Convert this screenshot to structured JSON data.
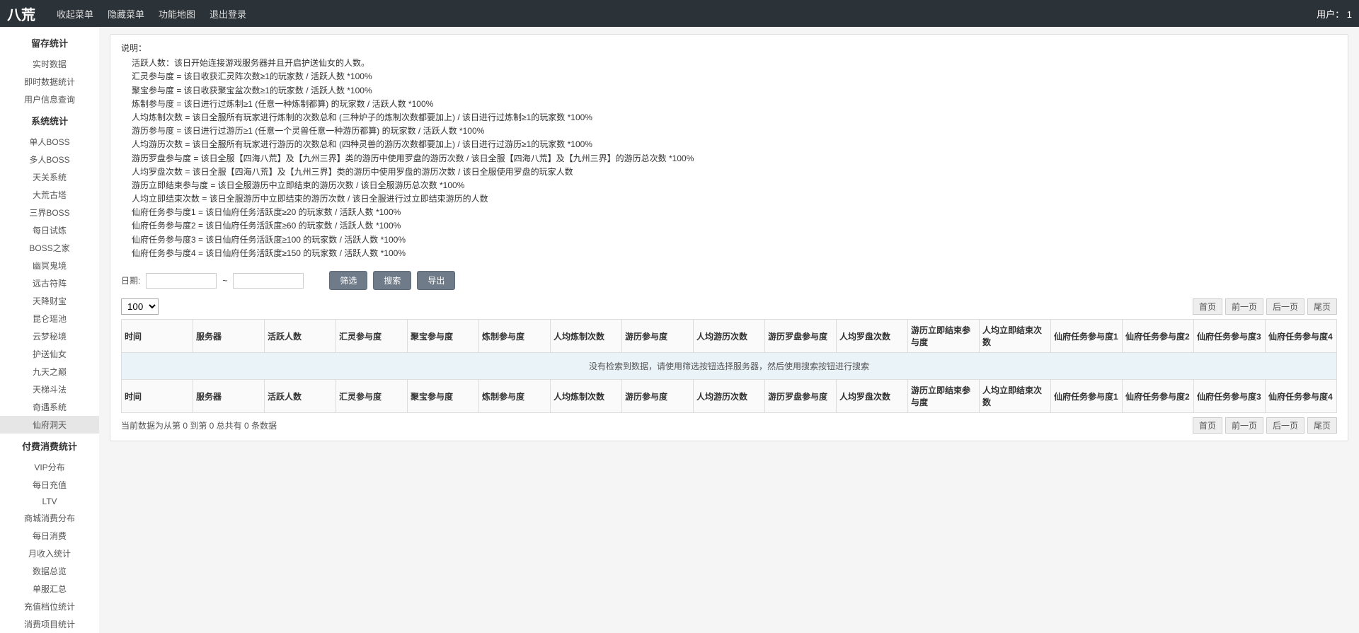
{
  "topbar": {
    "brand": "八荒",
    "links": {
      "collapse": "收起菜单",
      "hide": "隐藏菜单",
      "map": "功能地图",
      "logout": "退出登录"
    },
    "user_label": "用户：",
    "user_value": "1"
  },
  "sidebar": {
    "groups": [
      {
        "title": "留存统计",
        "items": [
          {
            "label": "实时数据"
          },
          {
            "label": "即时数据统计"
          },
          {
            "label": "用户信息查询"
          }
        ]
      },
      {
        "title": "系统统计",
        "items": [
          {
            "label": "单人BOSS"
          },
          {
            "label": "多人BOSS"
          },
          {
            "label": "天关系统"
          },
          {
            "label": "大荒古塔"
          },
          {
            "label": "三界BOSS"
          },
          {
            "label": "每日试炼"
          },
          {
            "label": "BOSS之家"
          },
          {
            "label": "幽冥鬼境"
          },
          {
            "label": "远古符阵"
          },
          {
            "label": "天降财宝"
          },
          {
            "label": "昆仑瑶池"
          },
          {
            "label": "云梦秘境"
          },
          {
            "label": "护送仙女"
          },
          {
            "label": "九天之巅"
          },
          {
            "label": "天梯斗法"
          },
          {
            "label": "奇遇系统"
          },
          {
            "label": "仙府洞天",
            "active": true
          }
        ]
      },
      {
        "title": "付费消费统计",
        "items": [
          {
            "label": "VIP分布"
          },
          {
            "label": "每日充值"
          },
          {
            "label": "LTV"
          },
          {
            "label": "商城消费分布"
          },
          {
            "label": "每日消费"
          },
          {
            "label": "月收入统计"
          },
          {
            "label": "数据总览"
          },
          {
            "label": "单服汇总"
          },
          {
            "label": "充值档位统计"
          },
          {
            "label": "消费项目统计"
          }
        ]
      }
    ]
  },
  "desc": {
    "title": "说明：",
    "lines": [
      "活跃人数：该日开始连接游戏服务器并且开启护送仙女的人数。",
      "汇灵参与度 = 该日收获汇灵阵次数≥1的玩家数 / 活跃人数 *100%",
      "聚宝参与度 = 该日收获聚宝盆次数≥1的玩家数 / 活跃人数 *100%",
      "炼制参与度 = 该日进行过炼制≥1 (任意一种炼制都算) 的玩家数 / 活跃人数 *100%",
      "人均炼制次数 = 该日全服所有玩家进行炼制的次数总和 (三种炉子的炼制次数都要加上) / 该日进行过炼制≥1的玩家数 *100%",
      "游历参与度 = 该日进行过游历≥1 (任意一个灵兽任意一种游历都算) 的玩家数 / 活跃人数 *100%",
      "人均游历次数 = 该日全服所有玩家进行游历的次数总和 (四种灵兽的游历次数都要加上) / 该日进行过游历≥1的玩家数 *100%",
      "游历罗盘参与度 = 该日全服【四海八荒】及【九州三界】类的游历中使用罗盘的游历次数 / 该日全服【四海八荒】及【九州三界】的游历总次数 *100%",
      "人均罗盘次数 = 该日全服【四海八荒】及【九州三界】类的游历中使用罗盘的游历次数 / 该日全服使用罗盘的玩家人数",
      "游历立即结束参与度 = 该日全服游历中立即结束的游历次数 / 该日全服游历总次数 *100%",
      "人均立即结束次数 = 该日全服游历中立即结束的游历次数 / 该日全服进行过立即结束游历的人数",
      "仙府任务参与度1 = 该日仙府任务活跃度≥20 的玩家数 / 活跃人数 *100%",
      "仙府任务参与度2 = 该日仙府任务活跃度≥60 的玩家数 / 活跃人数 *100%",
      "仙府任务参与度3 = 该日仙府任务活跃度≥100 的玩家数 / 活跃人数 *100%",
      "仙府任务参与度4 = 该日仙府任务活跃度≥150 的玩家数 / 活跃人数 *100%"
    ]
  },
  "filters": {
    "date_label": "日期:",
    "sep": "~",
    "filter_btn": "筛选",
    "search_btn": "搜索",
    "export_btn": "导出"
  },
  "table": {
    "page_size": "100",
    "pager": {
      "first": "首页",
      "prev": "前一页",
      "next": "后一页",
      "last": "尾页"
    },
    "columns": [
      "时间",
      "服务器",
      "活跃人数",
      "汇灵参与度",
      "聚宝参与度",
      "炼制参与度",
      "人均炼制次数",
      "游历参与度",
      "人均游历次数",
      "游历罗盘参与度",
      "人均罗盘次数",
      "游历立即结束参与度",
      "人均立即结束次数",
      "仙府任务参与度1",
      "仙府任务参与度2",
      "仙府任务参与度3",
      "仙府任务参与度4"
    ],
    "empty_text": "没有检索到数据，请使用筛选按钮选择服务器，然后使用搜索按钮进行搜索",
    "summary": "当前数据为从第 0 到第 0 总共有 0 条数据"
  }
}
